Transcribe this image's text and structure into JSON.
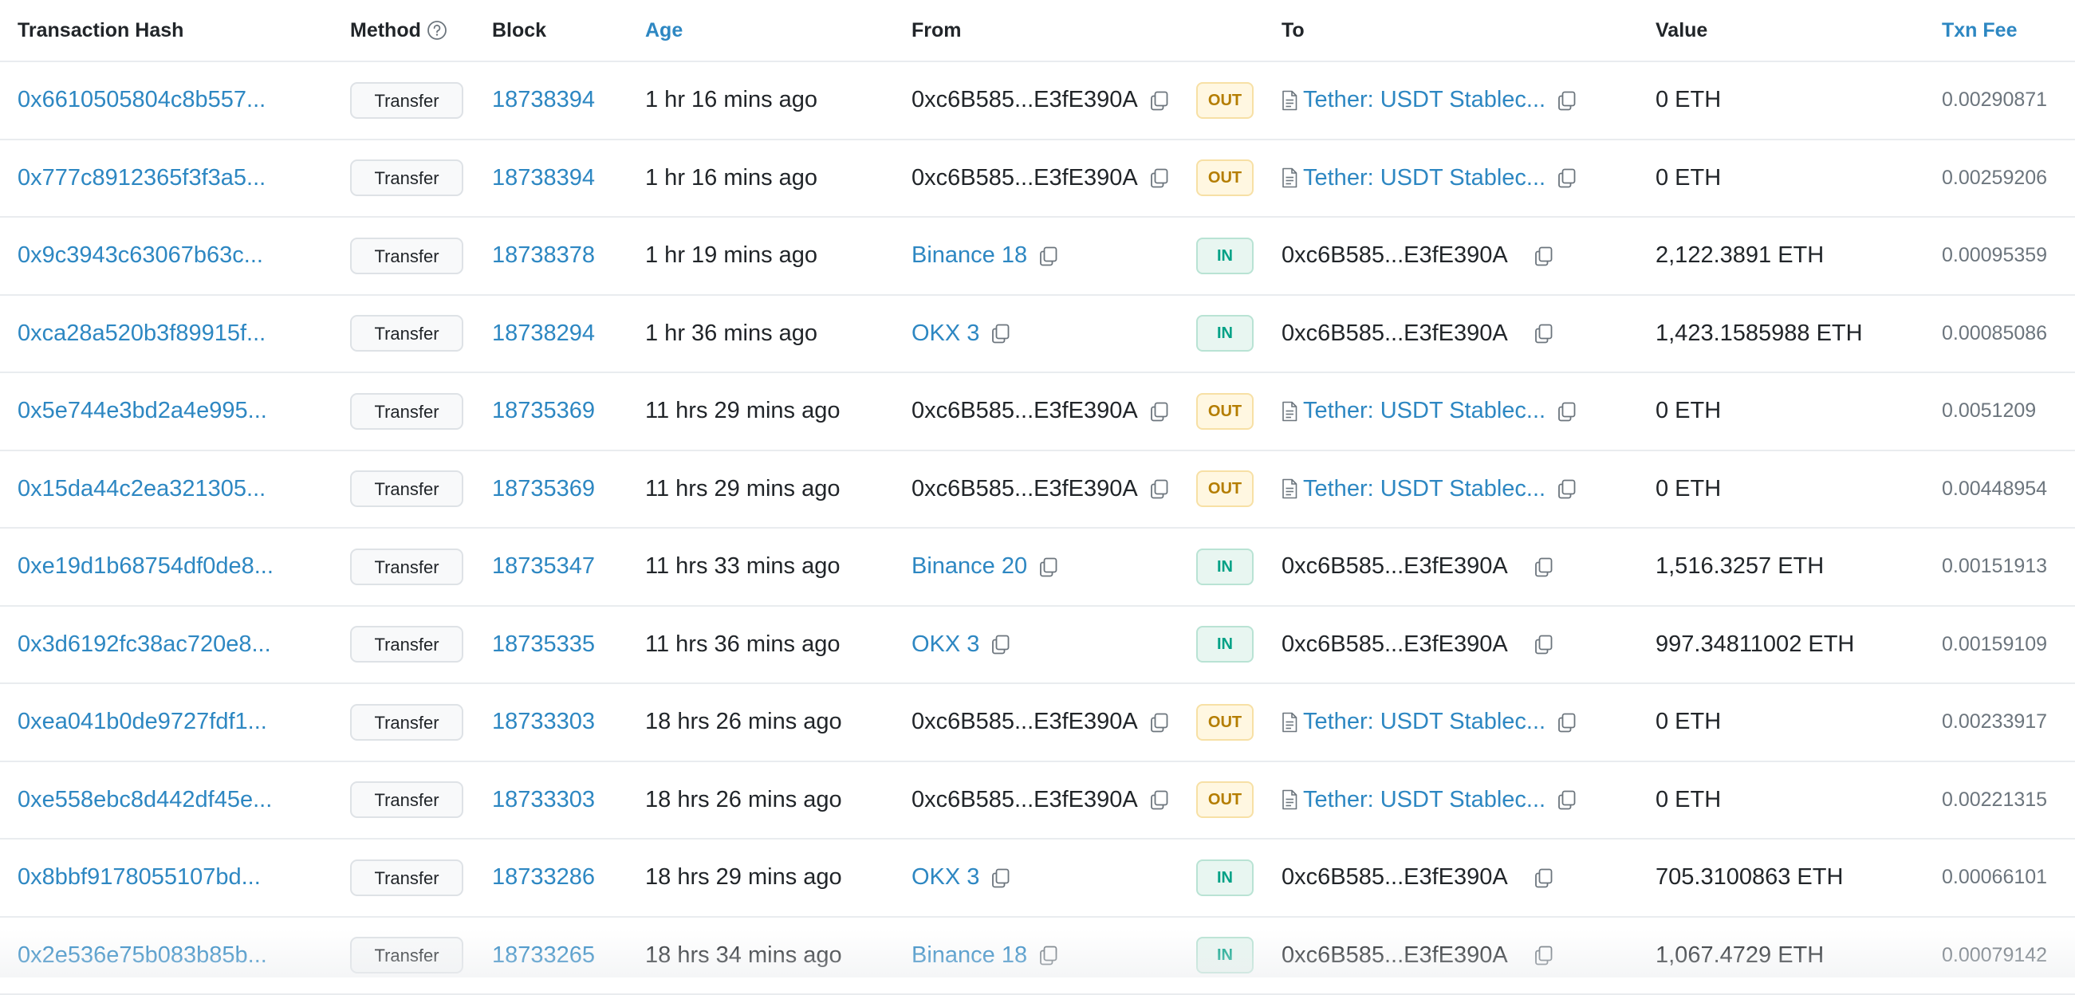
{
  "headers": {
    "hash": "Transaction Hash",
    "method": "Method",
    "block": "Block",
    "age": "Age",
    "from": "From",
    "to": "To",
    "value": "Value",
    "fee": "Txn Fee"
  },
  "icons": {
    "method_help": "question-circle-icon",
    "copy": "copy-icon",
    "contract": "document-icon"
  },
  "colors": {
    "link": "#2d87c2",
    "out_badge_text": "#b47d00",
    "out_badge_bg": "#fff7e1",
    "in_badge_text": "#00a186",
    "in_badge_bg": "#e8f6f1"
  },
  "rows": [
    {
      "hash": "0x6610505804c8b557...",
      "method": "Transfer",
      "block": "18738394",
      "age": "1 hr 16 mins ago",
      "from": "0xc6B585...E3fE390A",
      "direction": "OUT",
      "to": "Tether: USDT Stablec...",
      "value": "0 ETH",
      "fee": "0.00290871"
    },
    {
      "hash": "0x777c8912365f3f3a5...",
      "method": "Transfer",
      "block": "18738394",
      "age": "1 hr 16 mins ago",
      "from": "0xc6B585...E3fE390A",
      "direction": "OUT",
      "to": "Tether: USDT Stablec...",
      "value": "0 ETH",
      "fee": "0.00259206"
    },
    {
      "hash": "0x9c3943c63067b63c...",
      "method": "Transfer",
      "block": "18738378",
      "age": "1 hr 19 mins ago",
      "from": "Binance 18",
      "direction": "IN",
      "to": "0xc6B585...E3fE390A",
      "value": "2,122.3891 ETH",
      "fee": "0.00095359"
    },
    {
      "hash": "0xca28a520b3f89915f...",
      "method": "Transfer",
      "block": "18738294",
      "age": "1 hr 36 mins ago",
      "from": "OKX 3",
      "direction": "IN",
      "to": "0xc6B585...E3fE390A",
      "value": "1,423.1585988 ETH",
      "fee": "0.00085086"
    },
    {
      "hash": "0x5e744e3bd2a4e995...",
      "method": "Transfer",
      "block": "18735369",
      "age": "11 hrs 29 mins ago",
      "from": "0xc6B585...E3fE390A",
      "direction": "OUT",
      "to": "Tether: USDT Stablec...",
      "value": "0 ETH",
      "fee": "0.0051209"
    },
    {
      "hash": "0x15da44c2ea321305...",
      "method": "Transfer",
      "block": "18735369",
      "age": "11 hrs 29 mins ago",
      "from": "0xc6B585...E3fE390A",
      "direction": "OUT",
      "to": "Tether: USDT Stablec...",
      "value": "0 ETH",
      "fee": "0.00448954"
    },
    {
      "hash": "0xe19d1b68754df0de8...",
      "method": "Transfer",
      "block": "18735347",
      "age": "11 hrs 33 mins ago",
      "from": "Binance 20",
      "direction": "IN",
      "to": "0xc6B585...E3fE390A",
      "value": "1,516.3257 ETH",
      "fee": "0.00151913"
    },
    {
      "hash": "0x3d6192fc38ac720e8...",
      "method": "Transfer",
      "block": "18735335",
      "age": "11 hrs 36 mins ago",
      "from": "OKX 3",
      "direction": "IN",
      "to": "0xc6B585...E3fE390A",
      "value": "997.34811002 ETH",
      "fee": "0.00159109"
    },
    {
      "hash": "0xea041b0de9727fdf1...",
      "method": "Transfer",
      "block": "18733303",
      "age": "18 hrs 26 mins ago",
      "from": "0xc6B585...E3fE390A",
      "direction": "OUT",
      "to": "Tether: USDT Stablec...",
      "value": "0 ETH",
      "fee": "0.00233917"
    },
    {
      "hash": "0xe558ebc8d442df45e...",
      "method": "Transfer",
      "block": "18733303",
      "age": "18 hrs 26 mins ago",
      "from": "0xc6B585...E3fE390A",
      "direction": "OUT",
      "to": "Tether: USDT Stablec...",
      "value": "0 ETH",
      "fee": "0.00221315"
    },
    {
      "hash": "0x8bbf9178055107bd...",
      "method": "Transfer",
      "block": "18733286",
      "age": "18 hrs 29 mins ago",
      "from": "OKX 3",
      "direction": "IN",
      "to": "0xc6B585...E3fE390A",
      "value": "705.3100863 ETH",
      "fee": "0.00066101"
    },
    {
      "hash": "0x2e536e75b083b85b...",
      "method": "Transfer",
      "block": "18733265",
      "age": "18 hrs 34 mins ago",
      "from": "Binance 18",
      "direction": "IN",
      "to": "0xc6B585...E3fE390A",
      "value": "1,067.4729 ETH",
      "fee": "0.00079142"
    }
  ]
}
